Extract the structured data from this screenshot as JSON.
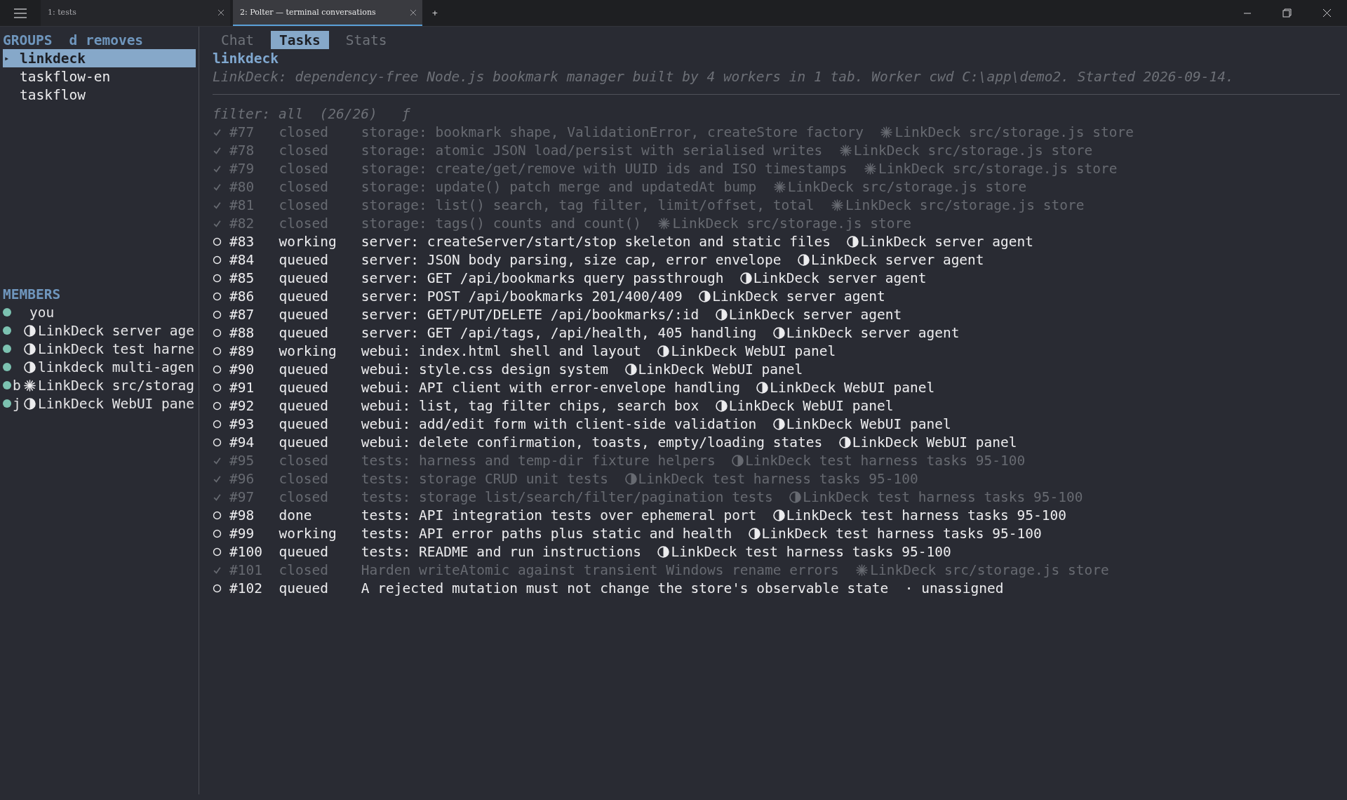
{
  "window_tabs": [
    {
      "label": "1: tests",
      "selected": false
    },
    {
      "label": "2: Polter — terminal conversations",
      "selected": true
    }
  ],
  "new_tab": "+",
  "sidebar": {
    "groups_heading": "GROUPS",
    "groups_hint": "d removes",
    "groups": [
      {
        "label": "linkdeck",
        "selected": true,
        "marker": "▸"
      },
      {
        "label": "taskflow-en",
        "selected": false
      },
      {
        "label": "taskflow",
        "selected": false
      }
    ],
    "members_heading": "MEMBERS",
    "members": [
      {
        "name": "you",
        "kind": "human"
      },
      {
        "name": "LinkDeck server age",
        "kind": "agent"
      },
      {
        "name": "LinkDeck test harne",
        "kind": "agent"
      },
      {
        "name": "linkdeck multi-agen",
        "kind": "agent"
      },
      {
        "name": "LinkDeck src/storag",
        "tag": "b",
        "kind": "store"
      },
      {
        "name": "LinkDeck WebUI pane",
        "tag": "j",
        "kind": "agent"
      }
    ]
  },
  "view_tabs": [
    {
      "label": "Chat",
      "selected": false
    },
    {
      "label": "Tasks",
      "selected": true
    },
    {
      "label": "Stats",
      "selected": false
    }
  ],
  "group": {
    "title": "linkdeck",
    "description": "LinkDeck: dependency-free Node.js bookmark manager built by 4 workers in 1 tab. Worker cwd C:\\app\\demo2. Started 2026-09-14."
  },
  "filter": "filter: all  (26/26)   ƒ",
  "tasks": [
    {
      "id": "#77",
      "status": "closed",
      "checked": true,
      "title": "storage: bookmark shape, ValidationError, createStore factory",
      "kind": "store",
      "assignee": "LinkDeck src/storage.js store"
    },
    {
      "id": "#78",
      "status": "closed",
      "checked": true,
      "title": "storage: atomic JSON load/persist with serialised writes",
      "kind": "store",
      "assignee": "LinkDeck src/storage.js store"
    },
    {
      "id": "#79",
      "status": "closed",
      "checked": true,
      "title": "storage: create/get/remove with UUID ids and ISO timestamps",
      "kind": "store",
      "assignee": "LinkDeck src/storage.js store"
    },
    {
      "id": "#80",
      "status": "closed",
      "checked": true,
      "title": "storage: update() patch merge and updatedAt bump",
      "kind": "store",
      "assignee": "LinkDeck src/storage.js store"
    },
    {
      "id": "#81",
      "status": "closed",
      "checked": true,
      "title": "storage: list() search, tag filter, limit/offset, total",
      "kind": "store",
      "assignee": "LinkDeck src/storage.js store"
    },
    {
      "id": "#82",
      "status": "closed",
      "checked": true,
      "title": "storage: tags() counts and count()",
      "kind": "store",
      "assignee": "LinkDeck src/storage.js store"
    },
    {
      "id": "#83",
      "status": "working",
      "checked": false,
      "title": "server: createServer/start/stop skeleton and static files",
      "kind": "agent",
      "assignee": "LinkDeck server agent"
    },
    {
      "id": "#84",
      "status": "queued",
      "checked": false,
      "title": "server: JSON body parsing, size cap, error envelope",
      "kind": "agent",
      "assignee": "LinkDeck server agent"
    },
    {
      "id": "#85",
      "status": "queued",
      "checked": false,
      "title": "server: GET /api/bookmarks query passthrough",
      "kind": "agent",
      "assignee": "LinkDeck server agent"
    },
    {
      "id": "#86",
      "status": "queued",
      "checked": false,
      "title": "server: POST /api/bookmarks 201/400/409",
      "kind": "agent",
      "assignee": "LinkDeck server agent"
    },
    {
      "id": "#87",
      "status": "queued",
      "checked": false,
      "title": "server: GET/PUT/DELETE /api/bookmarks/:id",
      "kind": "agent",
      "assignee": "LinkDeck server agent"
    },
    {
      "id": "#88",
      "status": "queued",
      "checked": false,
      "title": "server: GET /api/tags, /api/health, 405 handling",
      "kind": "agent",
      "assignee": "LinkDeck server agent"
    },
    {
      "id": "#89",
      "status": "working",
      "checked": false,
      "title": "webui: index.html shell and layout",
      "kind": "agent",
      "assignee": "LinkDeck WebUI panel"
    },
    {
      "id": "#90",
      "status": "queued",
      "checked": false,
      "title": "webui: style.css design system",
      "kind": "agent",
      "assignee": "LinkDeck WebUI panel"
    },
    {
      "id": "#91",
      "status": "queued",
      "checked": false,
      "title": "webui: API client with error-envelope handling",
      "kind": "agent",
      "assignee": "LinkDeck WebUI panel"
    },
    {
      "id": "#92",
      "status": "queued",
      "checked": false,
      "title": "webui: list, tag filter chips, search box",
      "kind": "agent",
      "assignee": "LinkDeck WebUI panel"
    },
    {
      "id": "#93",
      "status": "queued",
      "checked": false,
      "title": "webui: add/edit form with client-side validation",
      "kind": "agent",
      "assignee": "LinkDeck WebUI panel"
    },
    {
      "id": "#94",
      "status": "queued",
      "checked": false,
      "title": "webui: delete confirmation, toasts, empty/loading states",
      "kind": "agent",
      "assignee": "LinkDeck WebUI panel"
    },
    {
      "id": "#95",
      "status": "closed",
      "checked": true,
      "title": "tests: harness and temp-dir fixture helpers",
      "kind": "agent",
      "assignee": "LinkDeck test harness tasks 95-100"
    },
    {
      "id": "#96",
      "status": "closed",
      "checked": true,
      "title": "tests: storage CRUD unit tests",
      "kind": "agent",
      "assignee": "LinkDeck test harness tasks 95-100"
    },
    {
      "id": "#97",
      "status": "closed",
      "checked": true,
      "title": "tests: storage list/search/filter/pagination tests",
      "kind": "agent",
      "assignee": "LinkDeck test harness tasks 95-100"
    },
    {
      "id": "#98",
      "status": "done",
      "checked": false,
      "title": "tests: API integration tests over ephemeral port",
      "kind": "agent",
      "assignee": "LinkDeck test harness tasks 95-100"
    },
    {
      "id": "#99",
      "status": "working",
      "checked": false,
      "title": "tests: API error paths plus static and health",
      "kind": "agent",
      "assignee": "LinkDeck test harness tasks 95-100"
    },
    {
      "id": "#100",
      "status": "queued",
      "checked": false,
      "title": "tests: README and run instructions",
      "kind": "agent",
      "assignee": "LinkDeck test harness tasks 95-100"
    },
    {
      "id": "#101",
      "status": "closed",
      "checked": true,
      "title": "Harden writeAtomic against transient Windows rename errors",
      "kind": "store",
      "assignee": "LinkDeck src/storage.js store"
    },
    {
      "id": "#102",
      "status": "queued",
      "checked": false,
      "title": "A rejected mutation must not change the store's observable state",
      "kind": "unassigned",
      "assignee": "· unassigned"
    }
  ]
}
